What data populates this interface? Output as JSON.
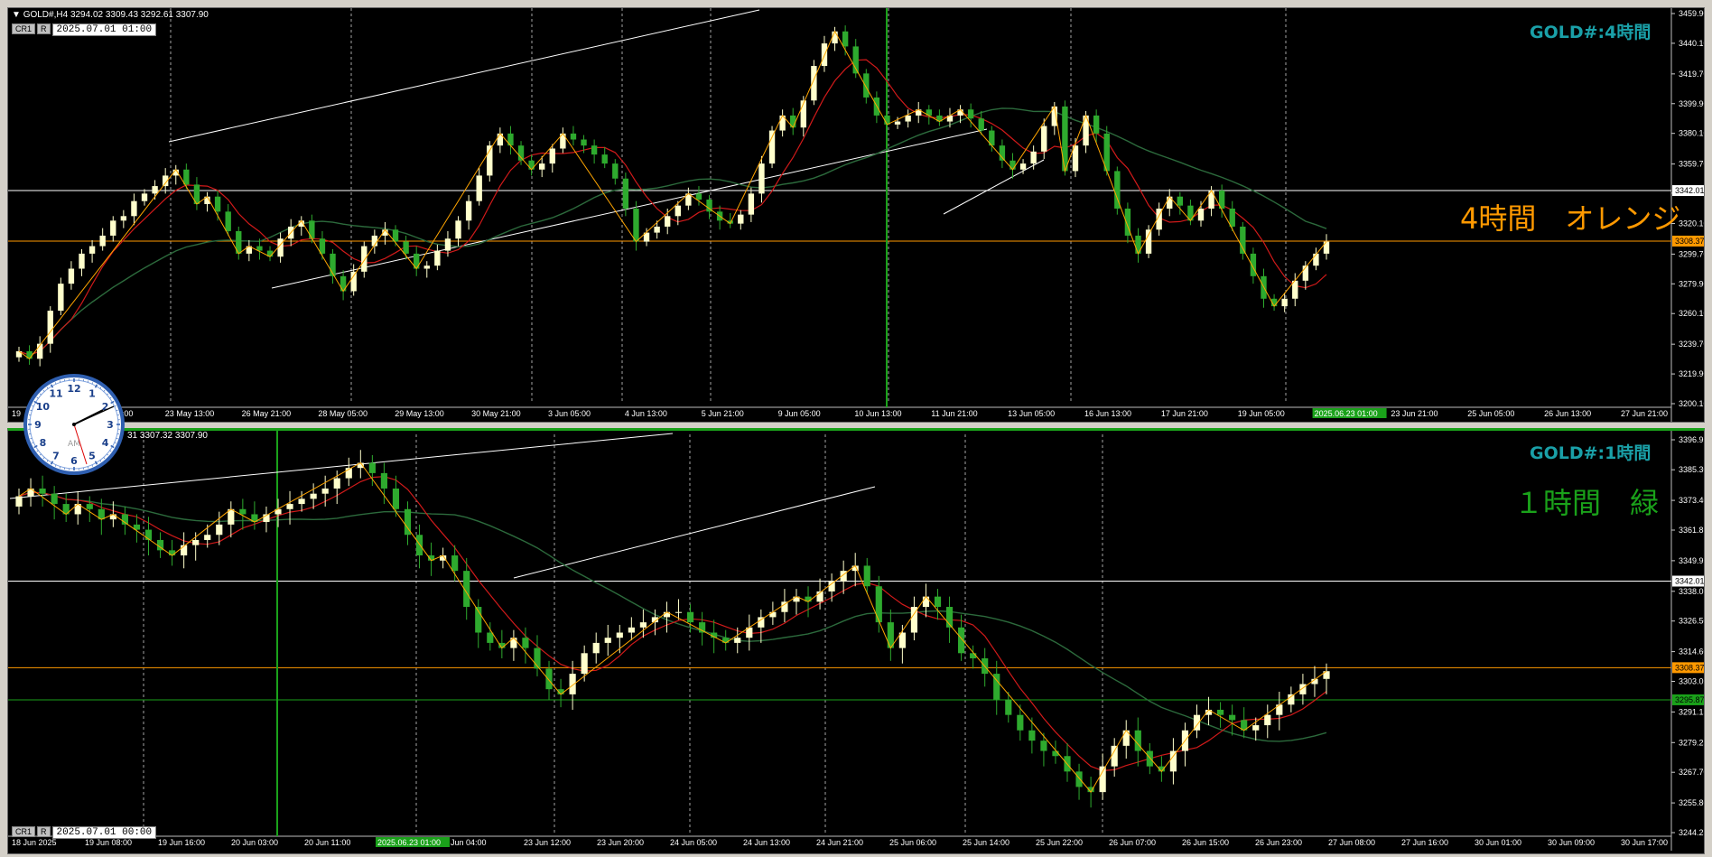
{
  "h4": {
    "header_symbol": "GOLD#,H4",
    "header_ohlc": "3294.02 3309.43 3292.61 3307.90",
    "tag_cr": "CR1",
    "tag_r": "R",
    "time": "2025.07.01 01:00",
    "corner_label": "GOLD#:4時間",
    "big_text": "4時間　オレンジ",
    "price_ticks": [
      "3459.90",
      "3440.10",
      "3419.70",
      "3399.90",
      "3380.10",
      "3359.70",
      "3340.30",
      "3320.10",
      "3299.70",
      "3279.90",
      "3260.10",
      "3239.70",
      "3219.90",
      "3200.10"
    ],
    "badges": [
      {
        "text": "3342.01",
        "price": 3342.01,
        "color": "#ffffff",
        "text_color": "#000000"
      },
      {
        "text": "3308.37",
        "price": 3308.37,
        "color": "#ff9900",
        "text_color": "#000000"
      }
    ],
    "time_ticks": [
      "19",
      "2 May 05:00",
      "23 May 13:00",
      "26 May 21:00",
      "28 May 05:00",
      "29 May 13:00",
      "30 May 21:00",
      "3 Jun 05:00",
      "4 Jun 13:00",
      "5 Jun 21:00",
      "9 Jun 05:00",
      "10 Jun 13:00",
      "11 Jun 21:00",
      "13 Jun 05:00",
      "16 Jun 13:00",
      "17 Jun 21:00",
      "19 Jun 05:00",
      "2025.06.23 01:00",
      "23 Jun 21:00",
      "25 Jun 05:00",
      "26 Jun 13:00",
      "27 Jun 21:00"
    ]
  },
  "h1": {
    "header_ohlc": "31 3307.32 3307.90",
    "tag_cr": "CR1",
    "tag_r": "R",
    "time": "2025.07.01 00:00",
    "corner_label": "GOLD#:1時間",
    "big_text": "１時間　緑",
    "price_ticks": [
      "3396.95",
      "3385.30",
      "3373.40",
      "3361.85",
      "3349.95",
      "3338.05",
      "3326.50",
      "3314.60",
      "3303.05",
      "3291.15",
      "3279.25",
      "3267.70",
      "3255.80",
      "3244.25"
    ],
    "badges": [
      {
        "text": "3342.01",
        "price": 3342.01,
        "color": "#ffffff",
        "text_color": "#000000"
      },
      {
        "text": "3308.37",
        "price": 3308.37,
        "color": "#ff9900",
        "text_color": "#000000"
      },
      {
        "text": "3295.87",
        "price": 3295.87,
        "color": "#1aa11a",
        "text_color": "#000000"
      }
    ],
    "time_ticks": [
      "18 Jun 2025",
      "19 Jun 08:00",
      "19 Jun 16:00",
      "20 Jun 03:00",
      "20 Jun 11:00",
      "2025.06.23 01:00",
      "Jun 04:00",
      "23 Jun 12:00",
      "23 Jun 20:00",
      "24 Jun 05:00",
      "24 Jun 13:00",
      "24 Jun 21:00",
      "25 Jun 06:00",
      "25 Jun 14:00",
      "25 Jun 22:00",
      "26 Jun 07:00",
      "26 Jun 15:00",
      "26 Jun 23:00",
      "27 Jun 08:00",
      "27 Jun 16:00",
      "30 Jun 01:00",
      "30 Jun 09:00",
      "30 Jun 17:00"
    ]
  },
  "clock": {
    "marker": "AM",
    "numbers": [
      "12",
      "1",
      "2",
      "3",
      "4",
      "5",
      "6",
      "7",
      "8",
      "9",
      "10",
      "11"
    ]
  },
  "colors": {
    "bull": "#ffffcc",
    "bear": "#2eaa2e",
    "ma_fast": "#d11a1a",
    "ma_slow": "#2c6a3c",
    "zigzag": "#ffa500",
    "trend": "#ffffff",
    "hline_white": "#ffffff",
    "hline_orange": "#ff9900",
    "hline_green": "#1aa11a",
    "vline": "#1aa11a",
    "grid": "#cccccc"
  },
  "chart_data": [
    {
      "type": "candlestick",
      "title": "GOLD#,H4",
      "ylim": [
        3200.1,
        3459.9
      ],
      "horizontal_lines": [
        3342.01,
        3308.37
      ],
      "close_series": [
        3235,
        3230,
        3240,
        3262,
        3280,
        3290,
        3300,
        3305,
        3312,
        3322,
        3325,
        3335,
        3340,
        3345,
        3352,
        3356,
        3346,
        3333,
        3338,
        3328,
        3315,
        3300,
        3305,
        3302,
        3298,
        3310,
        3318,
        3322,
        3310,
        3300,
        3285,
        3275,
        3288,
        3305,
        3312,
        3316,
        3308,
        3300,
        3290,
        3292,
        3302,
        3310,
        3322,
        3335,
        3352,
        3372,
        3380,
        3372,
        3362,
        3356,
        3360,
        3370,
        3380,
        3376,
        3372,
        3366,
        3360,
        3350,
        3330,
        3308,
        3314,
        3318,
        3325,
        3332,
        3340,
        3336,
        3328,
        3322,
        3320,
        3326,
        3340,
        3360,
        3382,
        3392,
        3384,
        3402,
        3425,
        3440,
        3448,
        3438,
        3420,
        3404,
        3392,
        3386,
        3388,
        3392,
        3396,
        3392,
        3388,
        3392,
        3396,
        3390,
        3382,
        3372,
        3362,
        3356,
        3360,
        3368,
        3385,
        3398,
        3355,
        3372,
        3392,
        3380,
        3355,
        3330,
        3312,
        3300,
        3316,
        3330,
        3338,
        3332,
        3322,
        3330,
        3342,
        3330,
        3318,
        3300,
        3285,
        3270,
        3265,
        3270,
        3282,
        3292,
        3300,
        3308
      ]
    },
    {
      "type": "candlestick",
      "title": "GOLD#,H1",
      "ylim": [
        3244.25,
        3396.95
      ],
      "horizontal_lines": [
        3342.01,
        3308.37,
        3295.87
      ],
      "close_series": [
        3375,
        3378,
        3376,
        3372,
        3368,
        3372,
        3370,
        3366,
        3368,
        3364,
        3362,
        3358,
        3354,
        3352,
        3356,
        3358,
        3360,
        3364,
        3370,
        3368,
        3365,
        3368,
        3370,
        3372,
        3374,
        3376,
        3378,
        3382,
        3386,
        3388,
        3384,
        3378,
        3370,
        3360,
        3352,
        3350,
        3352,
        3346,
        3332,
        3322,
        3318,
        3316,
        3320,
        3316,
        3308,
        3300,
        3298,
        3306,
        3314,
        3318,
        3320,
        3322,
        3324,
        3326,
        3328,
        3330,
        3330,
        3326,
        3322,
        3320,
        3318,
        3320,
        3324,
        3328,
        3330,
        3334,
        3336,
        3334,
        3338,
        3342,
        3346,
        3348,
        3340,
        3326,
        3316,
        3322,
        3332,
        3336,
        3332,
        3324,
        3314,
        3312,
        3306,
        3296,
        3290,
        3284,
        3280,
        3276,
        3274,
        3268,
        3262,
        3260,
        3270,
        3278,
        3284,
        3276,
        3270,
        3268,
        3276,
        3284,
        3290,
        3292,
        3290,
        3288,
        3284,
        3286,
        3290,
        3294,
        3298,
        3302,
        3304,
        3307
      ]
    }
  ]
}
